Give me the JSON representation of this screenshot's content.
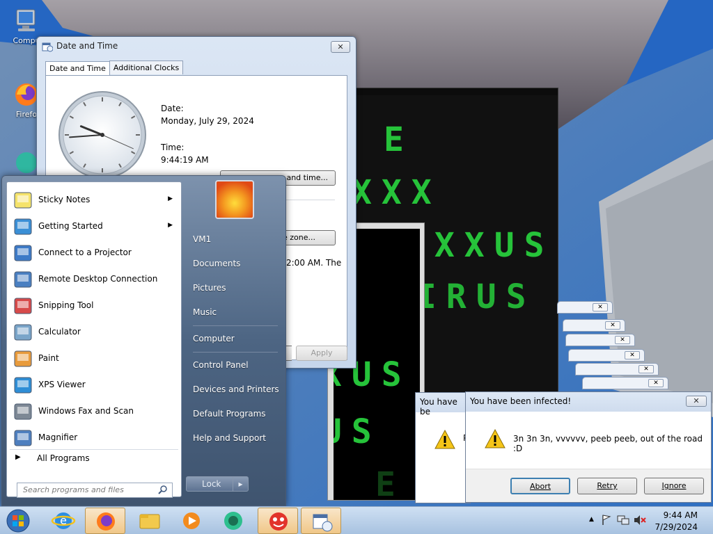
{
  "desktop": {
    "icons": [
      {
        "label": "Compu"
      },
      {
        "label": "Firefo"
      }
    ]
  },
  "virus": {
    "lines": [
      "E",
      "XXX",
      "EXXUS",
      "VIRUS",
      "XXUS",
      "RUS",
      "E"
    ]
  },
  "date_time_window": {
    "title": "Date and Time",
    "close_label": "✕",
    "tabs": [
      {
        "label": "Date and Time",
        "active": true
      },
      {
        "label": "Additional Clocks",
        "active": false
      }
    ],
    "date_label": "Date:",
    "date_value": "Monday, July 29, 2024",
    "time_label": "Time:",
    "time_value": "9:44:19 AM",
    "change_datetime_button": "and time...",
    "change_zone_button": "e zone...",
    "dst_text": "2:00 AM. The",
    "apply_button": "Apply",
    "clock": {
      "hour": 9,
      "minute": 44,
      "second": 19
    }
  },
  "dialogs": {
    "stacked_count": 5,
    "back_title": "You have be",
    "back_text": "P",
    "front": {
      "title": "You have been infected!",
      "message": "3n 3n 3n, vvvvvv, peeb peeb, out of the road :D",
      "close_label": "✕",
      "buttons": [
        "Abort",
        "Retry",
        "Ignore"
      ]
    }
  },
  "start_menu": {
    "programs": [
      {
        "label": "Sticky Notes",
        "icon": "sticky-notes-icon",
        "has_submenu": true
      },
      {
        "label": "Getting Started",
        "icon": "getting-started-icon",
        "has_submenu": true
      },
      {
        "label": "Connect to a Projector",
        "icon": "projector-icon",
        "has_submenu": false
      },
      {
        "label": "Remote Desktop Connection",
        "icon": "remote-desktop-icon",
        "has_submenu": false
      },
      {
        "label": "Snipping Tool",
        "icon": "scissors-icon",
        "has_submenu": false
      },
      {
        "label": "Calculator",
        "icon": "calculator-icon",
        "has_submenu": false
      },
      {
        "label": "Paint",
        "icon": "paint-icon",
        "has_submenu": false
      },
      {
        "label": "XPS Viewer",
        "icon": "xps-viewer-icon",
        "has_submenu": false
      },
      {
        "label": "Windows Fax and Scan",
        "icon": "fax-icon",
        "has_submenu": false
      },
      {
        "label": "Magnifier",
        "icon": "magnifier-icon",
        "has_submenu": false
      }
    ],
    "all_programs": "All Programs",
    "search_placeholder": "Search programs and files",
    "user": "VM1",
    "right_items": [
      "Documents",
      "Pictures",
      "Music",
      "Computer",
      "Control Panel",
      "Devices and Printers",
      "Default Programs",
      "Help and Support"
    ],
    "lock_label": "Lock",
    "lock_arrow": "▸"
  },
  "taskbar": {
    "apps": [
      "ie-icon",
      "firefox-icon",
      "explorer-icon",
      "media-player-icon",
      "chat-icon",
      "virus-app-icon",
      "datetime-icon"
    ],
    "time": "9:44 AM",
    "date": "7/29/2024"
  }
}
